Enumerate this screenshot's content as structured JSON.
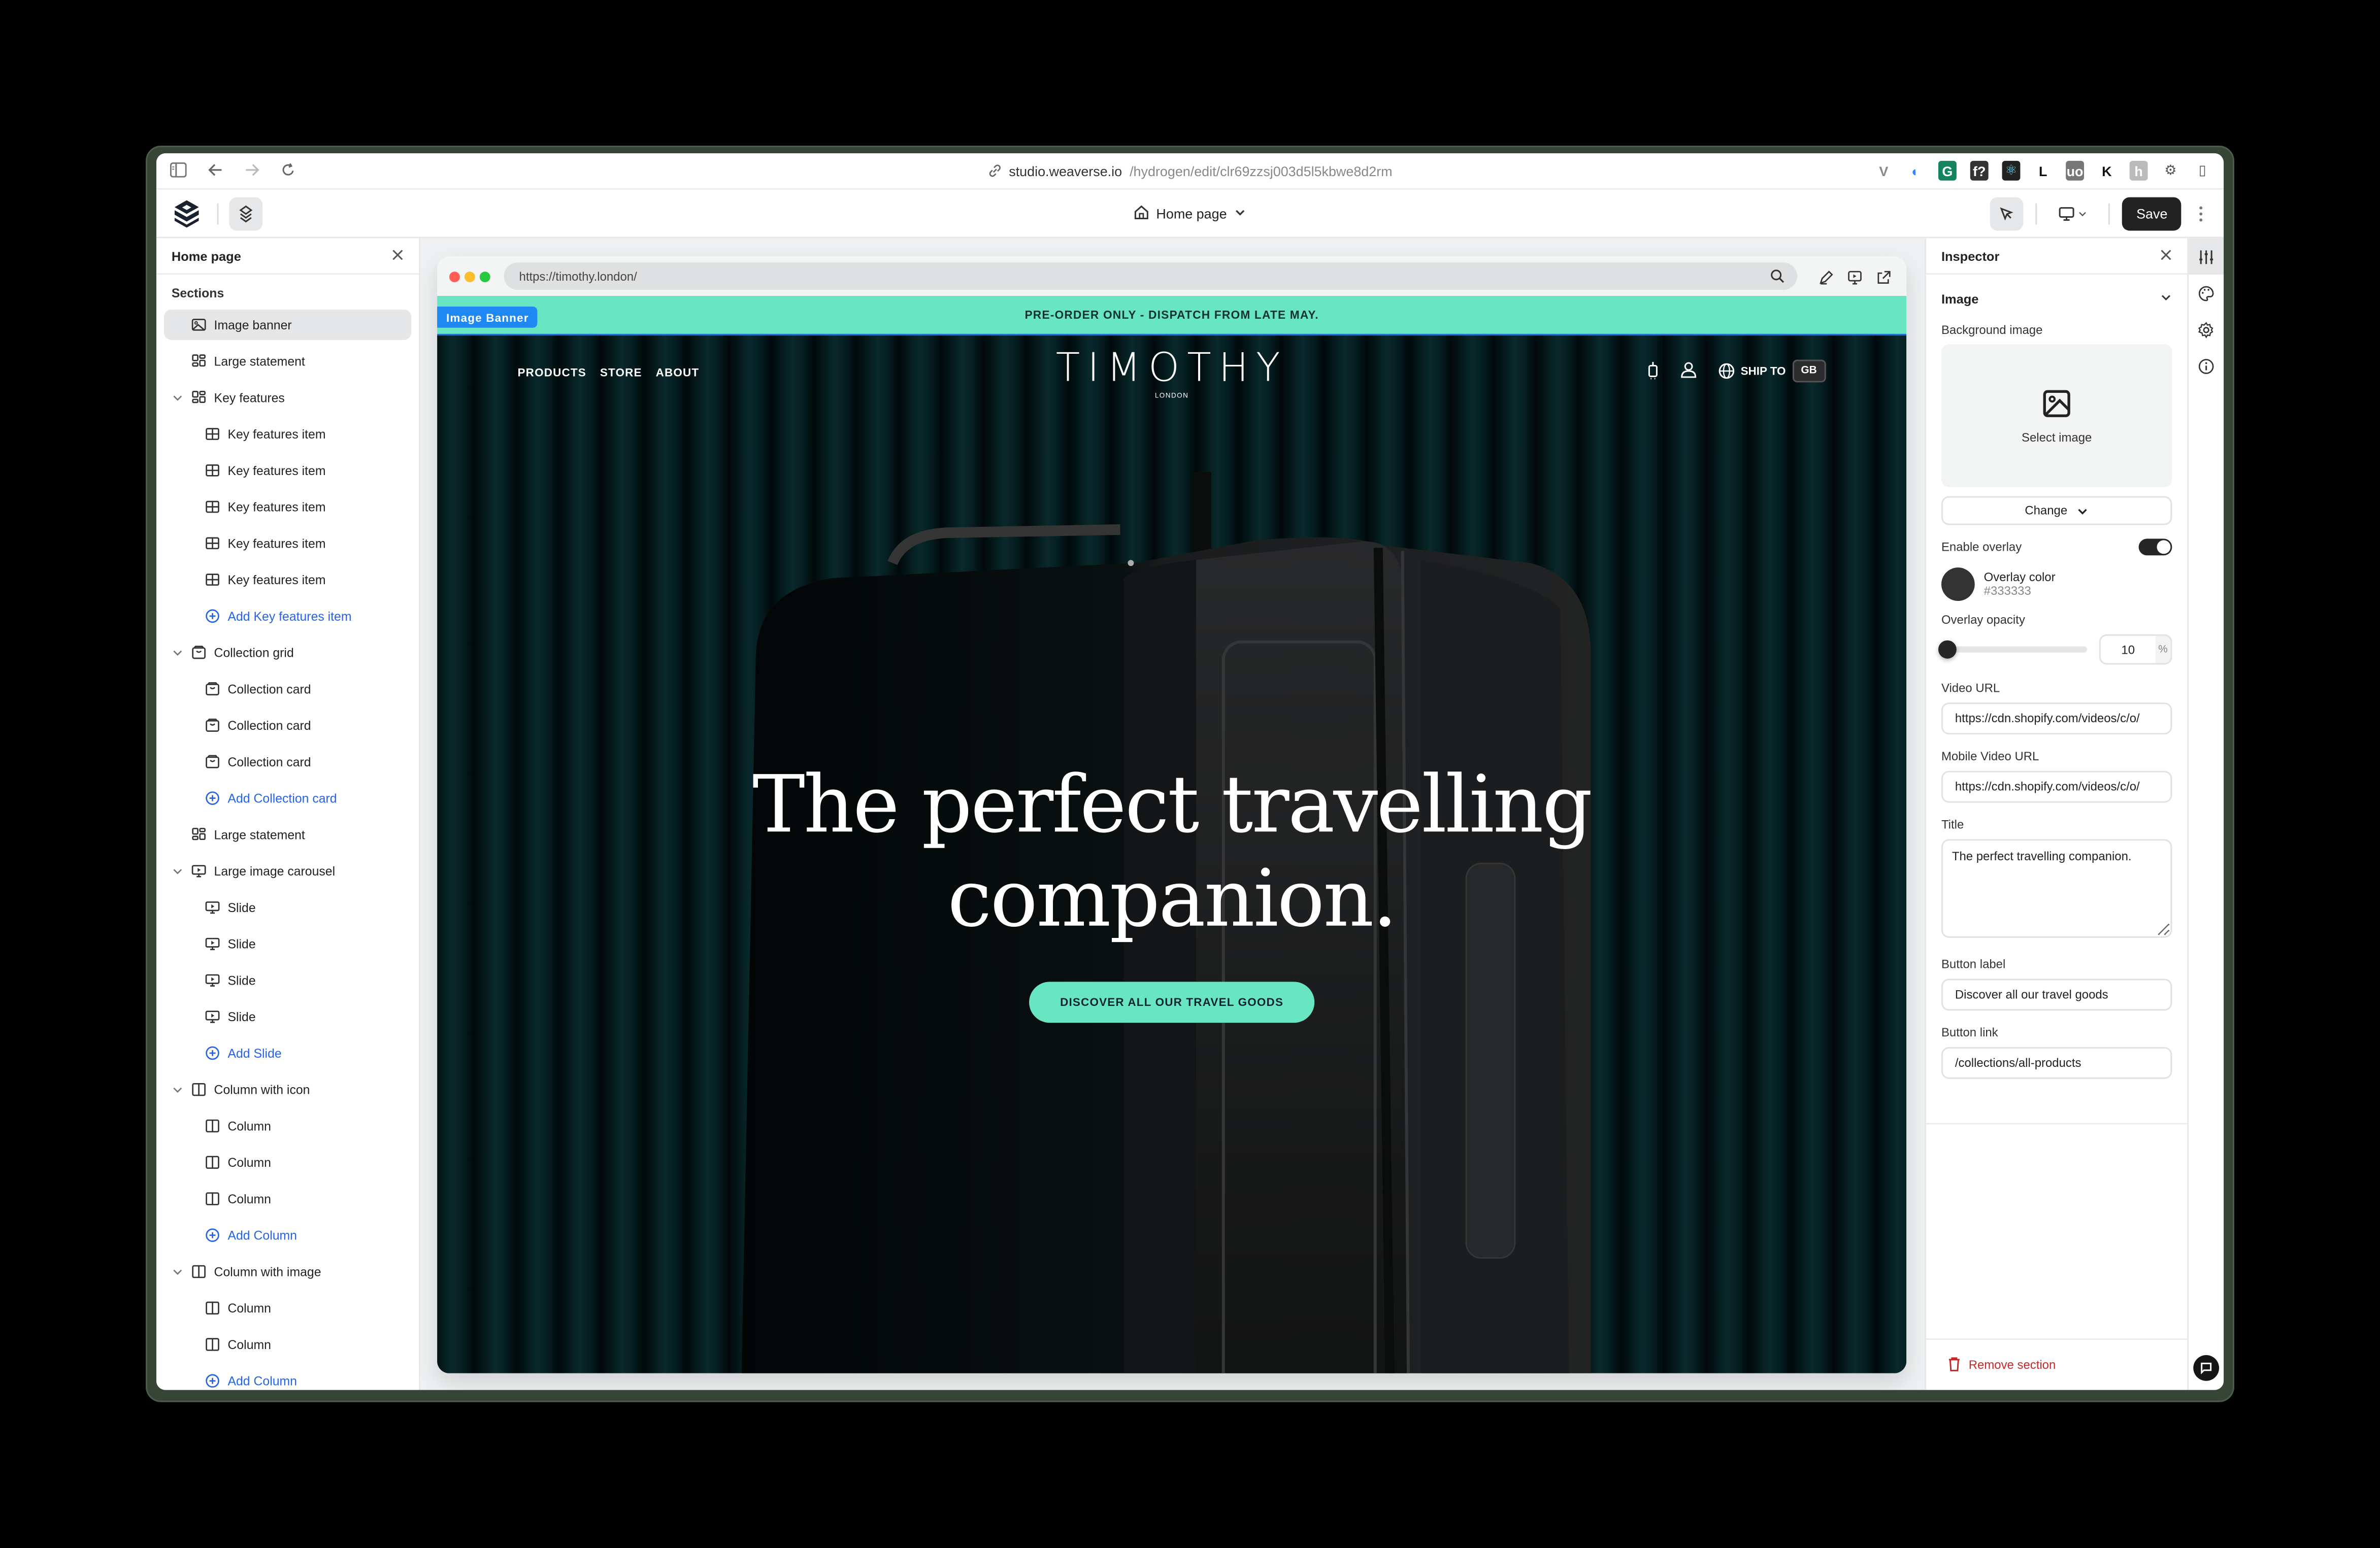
{
  "browser": {
    "url_host": "studio.weaverse.io",
    "url_path": "/hydrogen/edit/clr69zzsj003d5l5kbwe8d2rm",
    "extensions": [
      {
        "name": "vue-devtools",
        "glyph": "V",
        "color": "#888888",
        "bg": "transparent"
      },
      {
        "name": "lock-extension",
        "glyph": "◐",
        "color": "#3b82f6",
        "bg": "transparent"
      },
      {
        "name": "grammarly",
        "glyph": "G",
        "color": "#ffffff",
        "bg": "#15835f"
      },
      {
        "name": "font-ninja",
        "glyph": "f?",
        "color": "#ffffff",
        "bg": "#333333"
      },
      {
        "name": "react-devtools",
        "glyph": "⚛",
        "color": "#61dafb",
        "bg": "#222222"
      },
      {
        "name": "l-extension",
        "glyph": "L",
        "color": "#111111",
        "bg": "transparent"
      },
      {
        "name": "ublock-origin",
        "glyph": "uo",
        "color": "#ffffff",
        "bg": "#777777"
      },
      {
        "name": "k-extension",
        "glyph": "K",
        "color": "#111111",
        "bg": "transparent"
      },
      {
        "name": "honey",
        "glyph": "h",
        "color": "#ffffff",
        "bg": "#bbbbbb"
      },
      {
        "name": "extensions-menu",
        "glyph": "⚙",
        "color": "#555555",
        "bg": "transparent"
      },
      {
        "name": "split-view",
        "glyph": "▯",
        "color": "#555555",
        "bg": "transparent"
      }
    ]
  },
  "toolbar": {
    "page_label": "Home page",
    "save_label": "Save"
  },
  "sidebar": {
    "title": "Home page",
    "sections_label": "Sections",
    "items": [
      {
        "label": "Image banner",
        "level": 0,
        "icon": "image",
        "selected": true
      },
      {
        "label": "Large statement",
        "level": 0,
        "icon": "layout"
      },
      {
        "label": "Key features",
        "level": 0,
        "icon": "layout",
        "expandable": true
      },
      {
        "label": "Key features item",
        "level": 1,
        "icon": "grid"
      },
      {
        "label": "Key features item",
        "level": 1,
        "icon": "grid"
      },
      {
        "label": "Key features item",
        "level": 1,
        "icon": "grid"
      },
      {
        "label": "Key features item",
        "level": 1,
        "icon": "grid"
      },
      {
        "label": "Key features item",
        "level": 1,
        "icon": "grid"
      },
      {
        "label": "Add Key features item",
        "level": 1,
        "icon": "add",
        "add": true
      },
      {
        "label": "Collection grid",
        "level": 0,
        "icon": "bag",
        "expandable": true
      },
      {
        "label": "Collection card",
        "level": 1,
        "icon": "bag"
      },
      {
        "label": "Collection card",
        "level": 1,
        "icon": "bag"
      },
      {
        "label": "Collection card",
        "level": 1,
        "icon": "bag"
      },
      {
        "label": "Add Collection card",
        "level": 1,
        "icon": "add",
        "add": true
      },
      {
        "label": "Large statement",
        "level": 0,
        "icon": "layout"
      },
      {
        "label": "Large image carousel",
        "level": 0,
        "icon": "slides",
        "expandable": true
      },
      {
        "label": "Slide",
        "level": 1,
        "icon": "slides"
      },
      {
        "label": "Slide",
        "level": 1,
        "icon": "slides"
      },
      {
        "label": "Slide",
        "level": 1,
        "icon": "slides"
      },
      {
        "label": "Slide",
        "level": 1,
        "icon": "slides"
      },
      {
        "label": "Add Slide",
        "level": 1,
        "icon": "add",
        "add": true
      },
      {
        "label": "Column with icon",
        "level": 0,
        "icon": "columns",
        "expandable": true
      },
      {
        "label": "Column",
        "level": 1,
        "icon": "columns"
      },
      {
        "label": "Column",
        "level": 1,
        "icon": "columns"
      },
      {
        "label": "Column",
        "level": 1,
        "icon": "columns"
      },
      {
        "label": "Add Column",
        "level": 1,
        "icon": "add",
        "add": true
      },
      {
        "label": "Column with image",
        "level": 0,
        "icon": "columns",
        "expandable": true
      },
      {
        "label": "Column",
        "level": 1,
        "icon": "columns"
      },
      {
        "label": "Column",
        "level": 1,
        "icon": "columns"
      },
      {
        "label": "Add Column",
        "level": 1,
        "icon": "add",
        "add": true
      }
    ]
  },
  "preview": {
    "url": "https://timothy.london/",
    "section_tag": "Image Banner",
    "announcement": "PRE-ORDER ONLY - DISPATCH FROM LATE MAY.",
    "nav_links": [
      "PRODUCTS",
      "STORE",
      "ABOUT"
    ],
    "brand_name": "TIMOTHY",
    "brand_city": "LONDON",
    "ship_to_label": "SHIP TO",
    "country": "GB",
    "hero_title_line1": "The perfect travelling",
    "hero_title_line2": "companion.",
    "cta_label": "DISCOVER ALL OUR TRAVEL GOODS",
    "accent_color": "#67e6c1"
  },
  "inspector": {
    "title": "Inspector",
    "group_label": "Image",
    "background_image_label": "Background image",
    "select_image_label": "Select image",
    "change_label": "Change",
    "enable_overlay_label": "Enable overlay",
    "enable_overlay": true,
    "overlay_color_label": "Overlay color",
    "overlay_color": "#333333",
    "overlay_opacity_label": "Overlay opacity",
    "overlay_opacity": 10,
    "overlay_opacity_unit": "%",
    "video_url_label": "Video URL",
    "video_url": "https://cdn.shopify.com/videos/c/o/",
    "mobile_video_url_label": "Mobile Video URL",
    "mobile_video_url": "https://cdn.shopify.com/videos/c/o/",
    "title_label": "Title",
    "title_value": "The perfect travelling companion.",
    "button_label_label": "Button label",
    "button_label_value": "Discover all our travel goods",
    "button_link_label": "Button link",
    "button_link_value": "/collections/all-products",
    "remove_label": "Remove section"
  }
}
